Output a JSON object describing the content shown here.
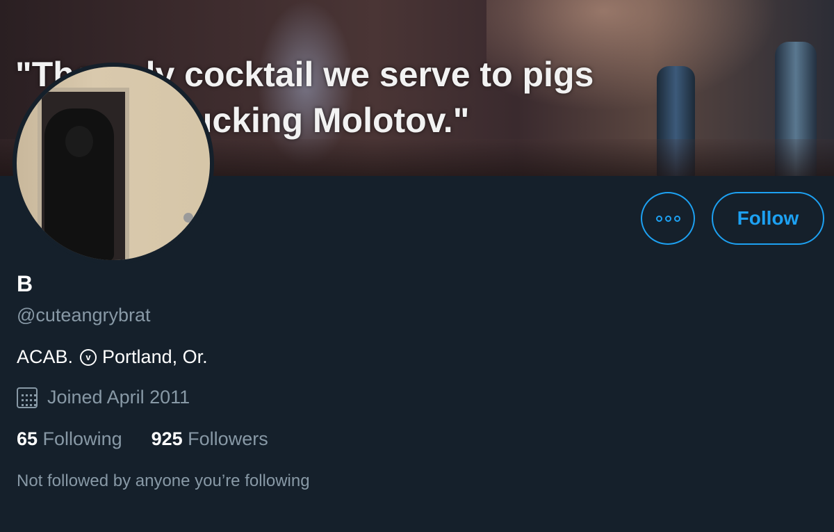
{
  "banner": {
    "quote": "\"The only cocktail we serve to pigs\n          is a fucking Molotov.\""
  },
  "profile": {
    "display_name": "B",
    "handle": "@cuteangrybrat",
    "bio_text": "ACAB.",
    "bio_location": "Portland, Or.",
    "joined": "Joined April 2011",
    "following_count": "65",
    "following_label": "Following",
    "followers_count": "925",
    "followers_label": "Followers",
    "mutuals_text": "Not followed by anyone you’re following"
  },
  "actions": {
    "follow_label": "Follow",
    "more_icon": "more-options-icon"
  },
  "colors": {
    "background": "#15202b",
    "accent": "#1da1f2",
    "secondary_text": "#8899a6"
  }
}
